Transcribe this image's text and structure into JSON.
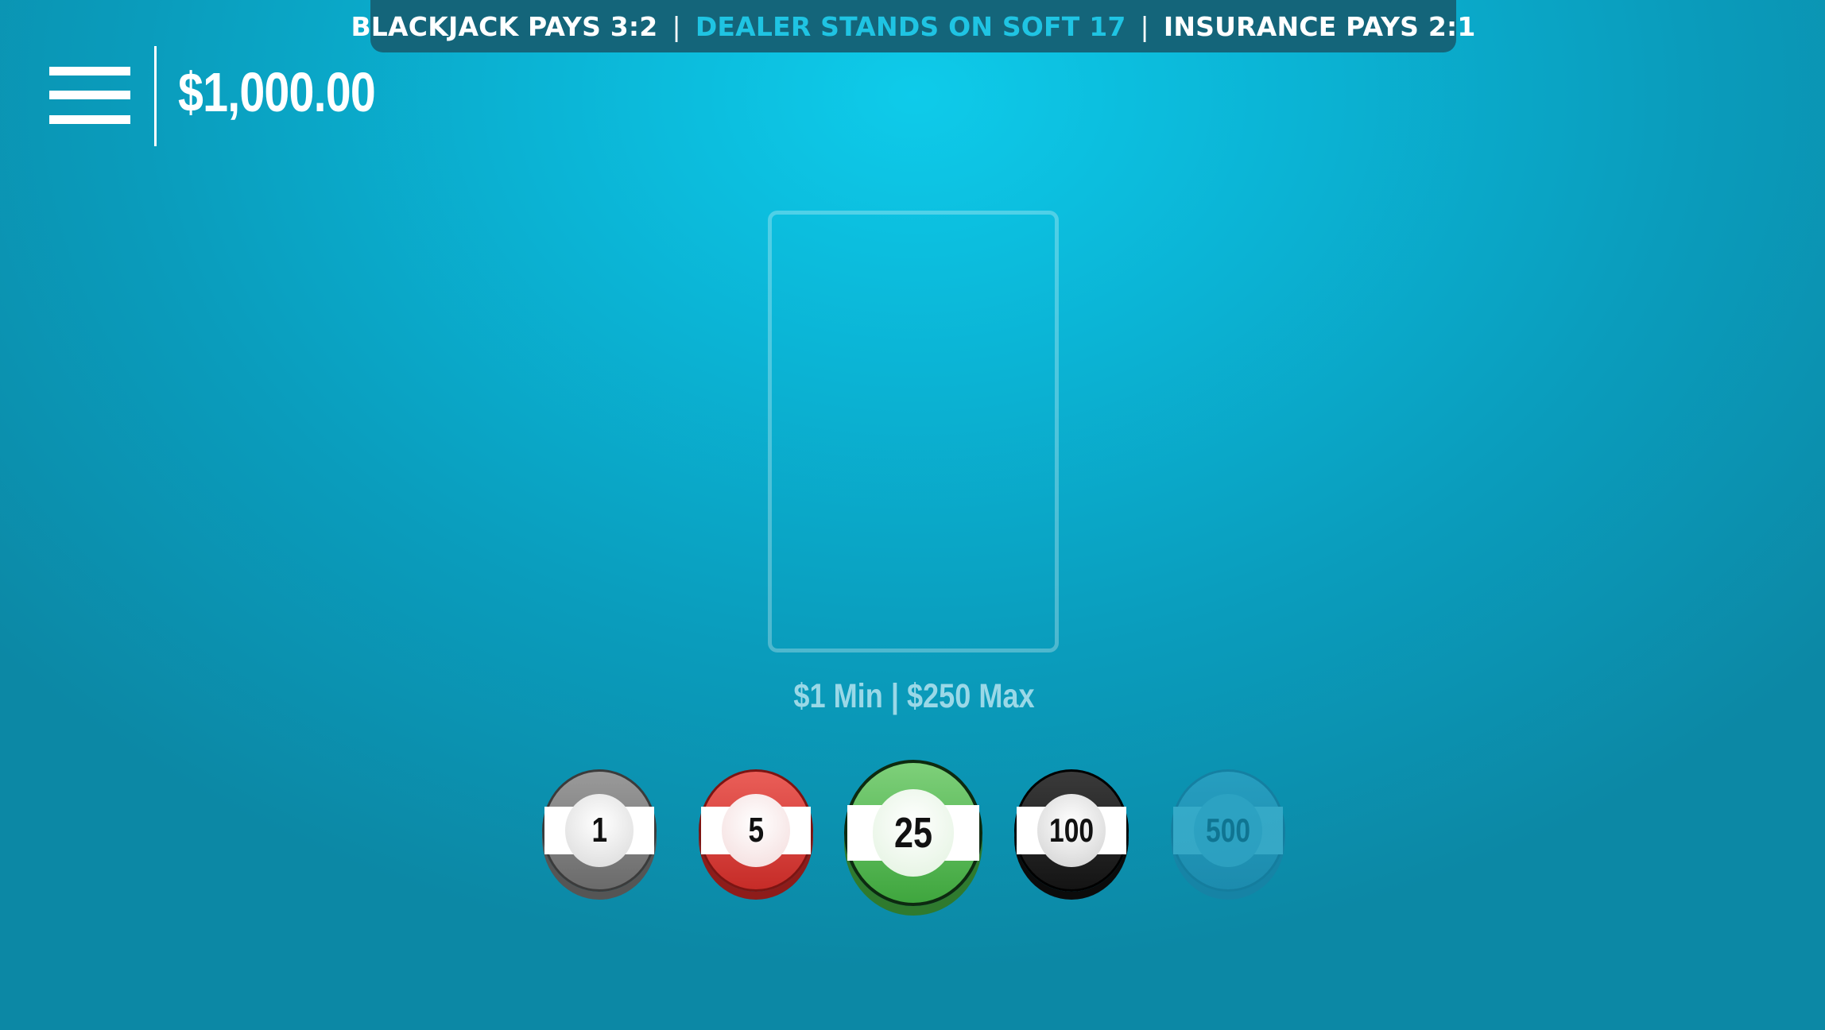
{
  "rules_banner": {
    "blackjack_pays": "BLACKJACK PAYS 3:2",
    "separator": "|",
    "dealer_rule": "DEALER STANDS ON SOFT 17",
    "insurance_pays": "INSURANCE PAYS 2:1"
  },
  "header": {
    "menu_icon": "hamburger-menu-icon",
    "balance": "$1,000.00"
  },
  "table": {
    "bet_limits": "$1 Min | $250 Max"
  },
  "chips": [
    {
      "label": "1",
      "color": "#8a8a8a",
      "enabled": true
    },
    {
      "label": "5",
      "color": "#d9403b",
      "enabled": true
    },
    {
      "label": "25",
      "color": "#5cba58",
      "enabled": true,
      "selected": true
    },
    {
      "label": "100",
      "color": "#222222",
      "enabled": true
    },
    {
      "label": "500",
      "color": "#2f9bc4",
      "enabled": false
    }
  ],
  "colors": {
    "table_felt": "#0bb5d6",
    "banner_bg": "#14657a",
    "banner_highlight": "#1fc4e3"
  }
}
